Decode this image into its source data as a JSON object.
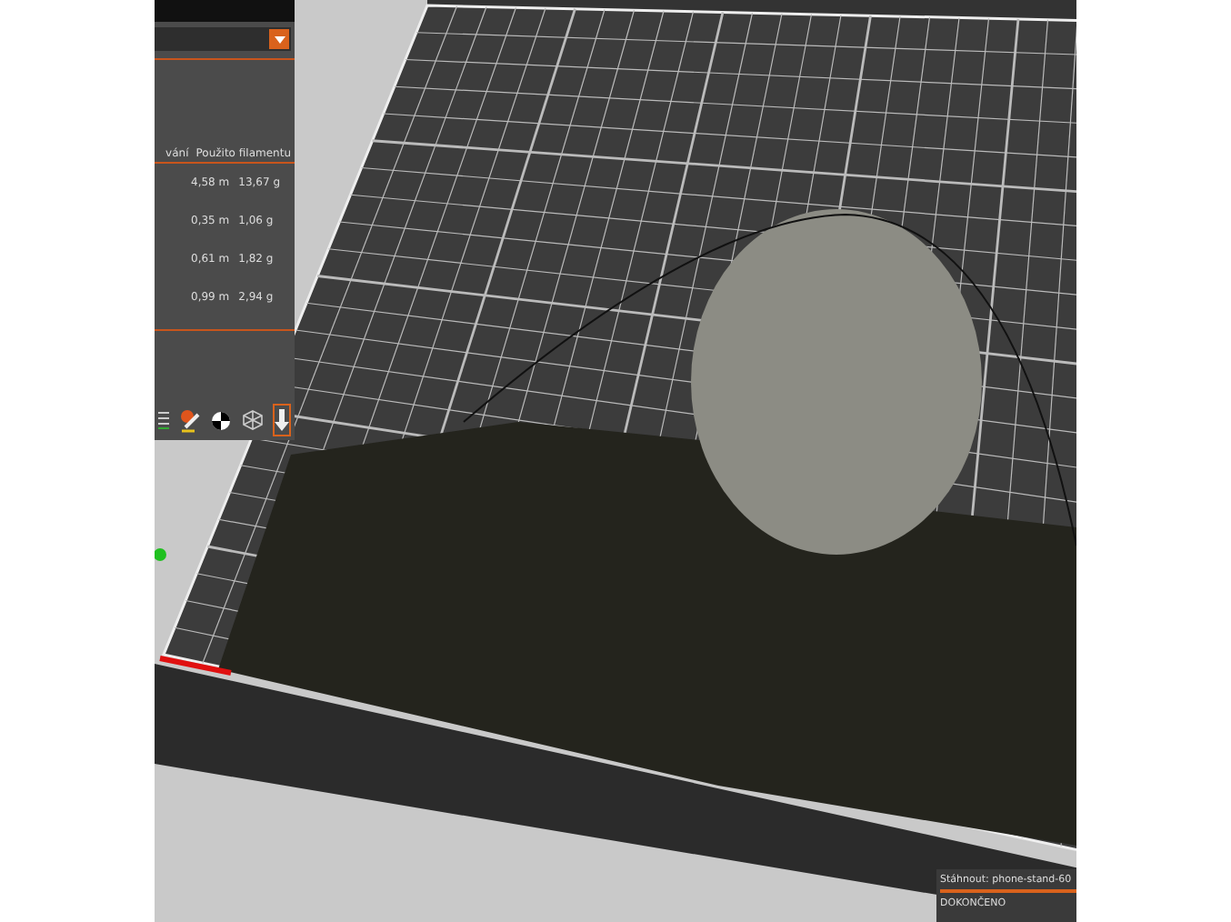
{
  "filament_table": {
    "columns": [
      "vání",
      "Použito filamentu"
    ],
    "rows": [
      {
        "length": "4,58 m",
        "weight": "13,67 g"
      },
      {
        "length": "0,35 m",
        "weight": "1,06 g"
      },
      {
        "length": "0,61 m",
        "weight": "1,82 g"
      },
      {
        "length": "0,99 m",
        "weight": "2,94 g"
      }
    ]
  },
  "notification": {
    "title": "Stáhnout: phone-stand-60",
    "level": 1,
    "status": "DOKONČENO"
  }
}
